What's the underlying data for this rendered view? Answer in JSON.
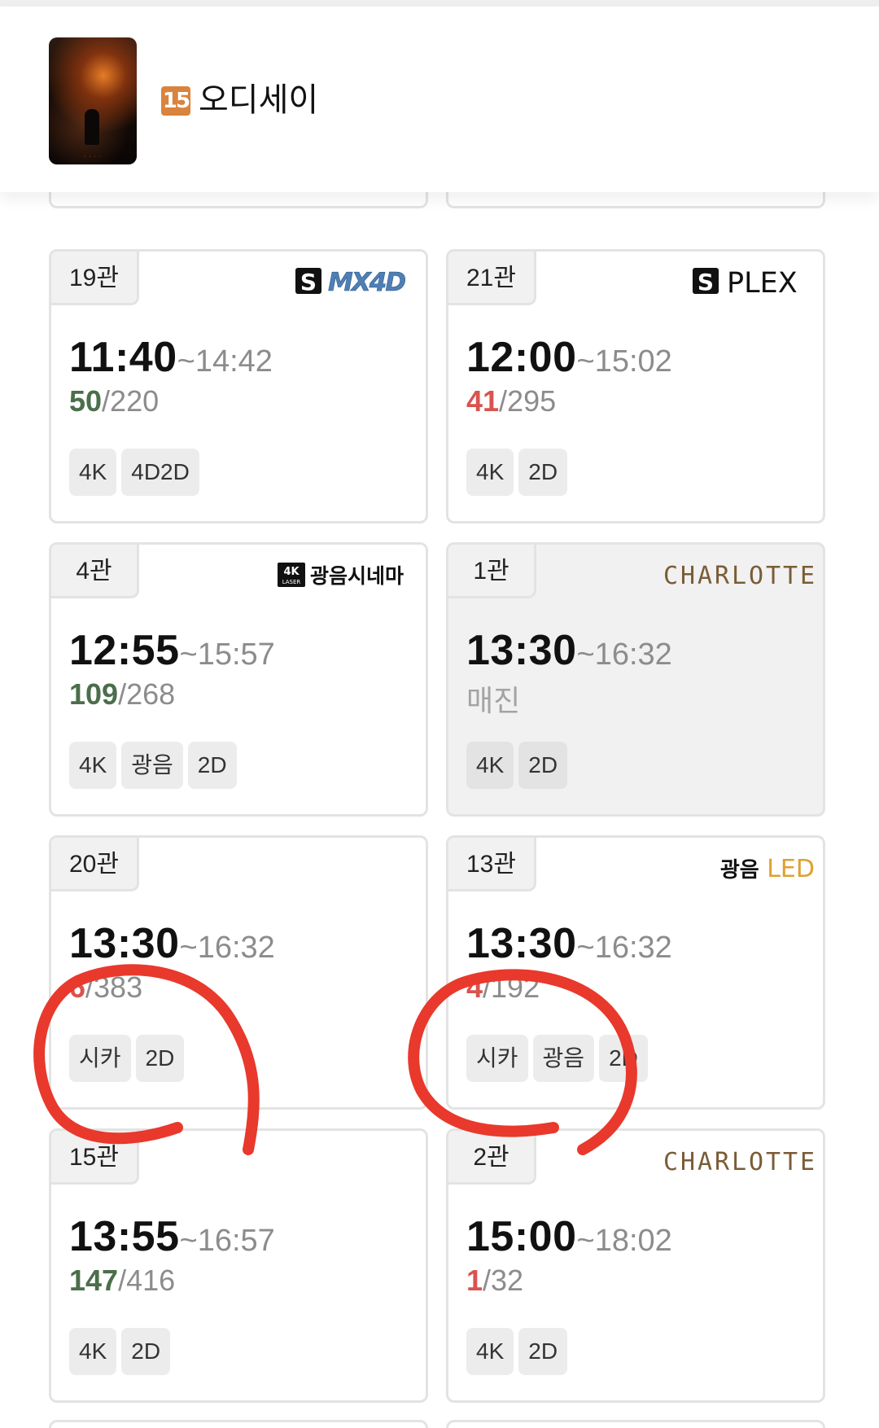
{
  "header": {
    "rating": "15",
    "title": "오디세이"
  },
  "brands": {
    "mx4d": "MX4D",
    "plex": "PLEX",
    "laser_top": "4K",
    "laser_bottom": "LASER",
    "gwangeum_cinema": "광음시네마",
    "charlotte": "CHARLOTTE",
    "gwangeum_led_prefix": "광음",
    "gwangeum_led_suffix": "LED"
  },
  "showtimes": [
    {
      "screen": "19관",
      "brand": "mx4d",
      "start": "11:40",
      "end": "~14:42",
      "available": "50",
      "total": "/220",
      "seat_color": "green",
      "tags": [
        "4K",
        "4D2D"
      ]
    },
    {
      "screen": "21관",
      "brand": "plex",
      "start": "12:00",
      "end": "~15:02",
      "available": "41",
      "total": "/295",
      "seat_color": "red",
      "tags": [
        "4K",
        "2D"
      ]
    },
    {
      "screen": "4관",
      "brand": "laser",
      "start": "12:55",
      "end": "~15:57",
      "available": "109",
      "total": "/268",
      "seat_color": "green",
      "tags": [
        "4K",
        "광음",
        "2D"
      ]
    },
    {
      "screen": "1관",
      "brand": "charlotte",
      "start": "13:30",
      "end": "~16:32",
      "status": "매진",
      "tags": [
        "4K",
        "2D"
      ]
    },
    {
      "screen": "20관",
      "brand": "",
      "start": "13:30",
      "end": "~16:32",
      "available": "6",
      "total": "/383",
      "seat_color": "red",
      "tags": [
        "시카",
        "2D"
      ]
    },
    {
      "screen": "13관",
      "brand": "led",
      "start": "13:30",
      "end": "~16:32",
      "available": "4",
      "total": "/192",
      "seat_color": "red",
      "tags": [
        "시카",
        "광음",
        "2D"
      ]
    },
    {
      "screen": "15관",
      "brand": "",
      "start": "13:55",
      "end": "~16:57",
      "available": "147",
      "total": "/416",
      "seat_color": "green",
      "tags": [
        "4K",
        "2D"
      ]
    },
    {
      "screen": "2관",
      "brand": "charlotte",
      "start": "15:00",
      "end": "~18:02",
      "available": "1",
      "total": "/32",
      "seat_color": "red",
      "tags": [
        "4K",
        "2D"
      ]
    }
  ],
  "colors": {
    "seat_green": "#4b6e4b",
    "seat_red": "#d9534f",
    "rating_orange": "#d9833d",
    "annotation_red": "#e8392c",
    "charlotte_gold": "#7a5c36"
  }
}
